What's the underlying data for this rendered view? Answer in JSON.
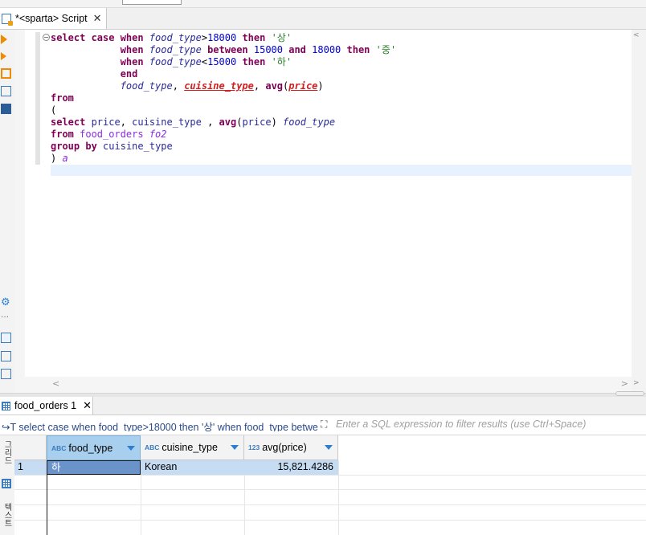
{
  "editor_tab": {
    "title": "*<sparta> Script",
    "close": "✕"
  },
  "code": {
    "lines": [
      [
        {
          "c": "kw",
          "t": "select "
        },
        {
          "c": "kw",
          "t": "case "
        },
        {
          "c": "kw",
          "t": "when "
        },
        {
          "c": "it",
          "t": "food_type"
        },
        {
          "c": "plain",
          "t": ">"
        },
        {
          "c": "num",
          "t": "18000 "
        },
        {
          "c": "kw",
          "t": "then "
        },
        {
          "c": "str",
          "t": "'상'"
        }
      ],
      [
        {
          "c": "plain",
          "t": "            "
        },
        {
          "c": "kw",
          "t": "when "
        },
        {
          "c": "it",
          "t": "food_type "
        },
        {
          "c": "kw",
          "t": "between "
        },
        {
          "c": "num",
          "t": "15000 "
        },
        {
          "c": "kw",
          "t": "and "
        },
        {
          "c": "num",
          "t": "18000 "
        },
        {
          "c": "kw",
          "t": "then "
        },
        {
          "c": "str",
          "t": "'중'"
        }
      ],
      [
        {
          "c": "plain",
          "t": "            "
        },
        {
          "c": "kw",
          "t": "when "
        },
        {
          "c": "it",
          "t": "food_type"
        },
        {
          "c": "plain",
          "t": "<"
        },
        {
          "c": "num",
          "t": "15000 "
        },
        {
          "c": "kw",
          "t": "then "
        },
        {
          "c": "str",
          "t": "'하'"
        }
      ],
      [
        {
          "c": "plain",
          "t": "            "
        },
        {
          "c": "kw",
          "t": "end"
        }
      ],
      [
        {
          "c": "plain",
          "t": "            "
        },
        {
          "c": "it",
          "t": "food_type"
        },
        {
          "c": "plain",
          "t": ", "
        },
        {
          "c": "err",
          "t": "cuisine_type"
        },
        {
          "c": "plain",
          "t": ", "
        },
        {
          "c": "kw",
          "t": "avg"
        },
        {
          "c": "plain",
          "t": "("
        },
        {
          "c": "err",
          "t": "price"
        },
        {
          "c": "plain",
          "t": ")"
        }
      ],
      [
        {
          "c": "kw",
          "t": "from"
        }
      ],
      [
        {
          "c": "plain",
          "t": "("
        }
      ],
      [
        {
          "c": "kw",
          "t": "select "
        },
        {
          "c": "idf",
          "t": "price"
        },
        {
          "c": "plain",
          "t": ", "
        },
        {
          "c": "idf",
          "t": "cuisine_type "
        },
        {
          "c": "plain",
          "t": ", "
        },
        {
          "c": "kw",
          "t": "avg"
        },
        {
          "c": "plain",
          "t": "("
        },
        {
          "c": "idf",
          "t": "price"
        },
        {
          "c": "plain",
          "t": ") "
        },
        {
          "c": "it",
          "t": "food_type"
        }
      ],
      [
        {
          "c": "kw",
          "t": "from "
        },
        {
          "c": "tbl",
          "t": "food_orders "
        },
        {
          "c": "alias",
          "t": "fo2"
        }
      ],
      [
        {
          "c": "kw",
          "t": "group "
        },
        {
          "c": "kw",
          "t": "by "
        },
        {
          "c": "idf",
          "t": "cuisine_type"
        }
      ],
      [
        {
          "c": "plain",
          "t": ") "
        },
        {
          "c": "alias",
          "t": "a"
        }
      ]
    ]
  },
  "results_tab": {
    "label": "food_orders 1",
    "close": "✕"
  },
  "filter": {
    "query_text": "↪T select case when food_type>18000 then '상' when food_type betwee",
    "expand_icon": "⛶",
    "placeholder": "Enter a SQL expression to filter results (use Ctrl+Space)"
  },
  "grid": {
    "columns": [
      {
        "type": "ABC",
        "label": "food_type"
      },
      {
        "type": "ABC",
        "label": "cuisine_type"
      },
      {
        "type": "123",
        "label": "avg(price)"
      }
    ],
    "rows": [
      {
        "num": "1",
        "food_type": "하",
        "cuisine_type": "Korean",
        "avg_price": "15,821.4286"
      }
    ]
  },
  "side_tabs": {
    "grid_label": "그리드",
    "text_label": "텍스트"
  },
  "colors": {
    "accent": "#3b7bbf",
    "selected_header": "#a9cfee",
    "selected_row": "#c5dcf3",
    "current_line": "#e8f2fe"
  }
}
